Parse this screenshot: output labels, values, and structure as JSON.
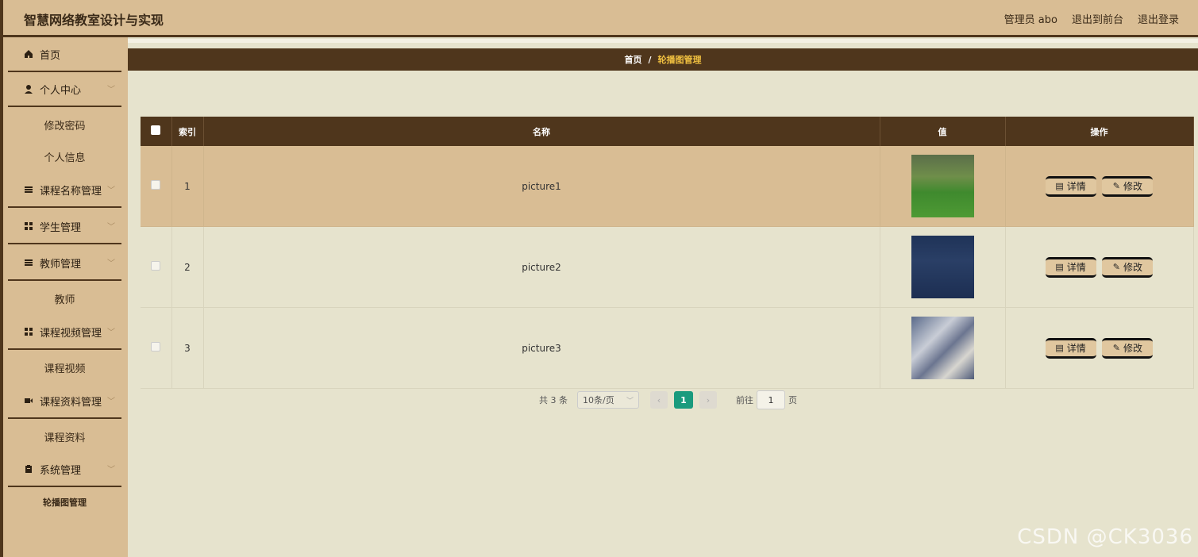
{
  "header": {
    "app_title": "智慧网络教室设计与实现",
    "user_label": "管理员 abo",
    "to_front_label": "退出到前台",
    "logout_label": "退出登录"
  },
  "sidebar": {
    "items": [
      {
        "label": "首页",
        "icon": "home-icon"
      },
      {
        "label": "个人中心",
        "icon": "user-icon"
      },
      {
        "label": "修改密码"
      },
      {
        "label": "个人信息"
      },
      {
        "label": "课程名称管理",
        "icon": "list-icon"
      },
      {
        "label": "学生管理",
        "icon": "grid-icon"
      },
      {
        "label": "教师管理",
        "icon": "list-icon"
      },
      {
        "label": "教师"
      },
      {
        "label": "课程视频管理",
        "icon": "grid-icon"
      },
      {
        "label": "课程视频"
      },
      {
        "label": "课程资料管理",
        "icon": "video-icon"
      },
      {
        "label": "课程资料"
      },
      {
        "label": "系统管理",
        "icon": "clipboard-icon"
      },
      {
        "label": "轮播图管理"
      }
    ]
  },
  "breadcrumb": {
    "home": "首页",
    "sep": "/",
    "current": "轮播图管理"
  },
  "table": {
    "headers": {
      "index": "索引",
      "name": "名称",
      "value": "值",
      "actions": "操作"
    },
    "rows": [
      {
        "index": "1",
        "name": "picture1",
        "thumb_color": "#4f7a3a"
      },
      {
        "index": "2",
        "name": "picture2",
        "thumb_color": "#24365a"
      },
      {
        "index": "3",
        "name": "picture3",
        "thumb_color": "#7a8090"
      }
    ],
    "detail_label": "详情",
    "edit_label": "修改"
  },
  "pagination": {
    "total_label": "共 3 条",
    "page_size": "10条/页",
    "current_page": "1",
    "goto_label": "前往",
    "goto_value": "1",
    "page_suffix": "页"
  },
  "watermark": "CSDN @CK3036",
  "colors": {
    "accent": "#4f361c",
    "sidebar": "#d9bd94",
    "page_active": "#1a9b7d",
    "breadcrumb_current": "#f0c040"
  }
}
